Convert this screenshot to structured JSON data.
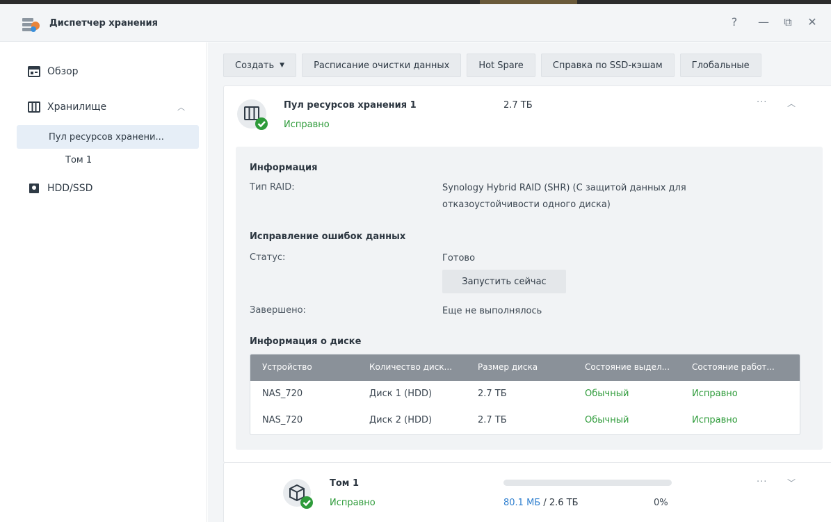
{
  "window": {
    "title": "Диспетчер хранения",
    "controls": [
      "?",
      "—",
      "⧉",
      "✕"
    ]
  },
  "sidebar": {
    "items": [
      {
        "label": "Обзор",
        "icon": "overview-icon"
      },
      {
        "label": "Хранилище",
        "icon": "storage-icon",
        "expanded": true
      },
      {
        "label": "Пул ресурсов хранени...",
        "active": true
      },
      {
        "label": "Том 1"
      },
      {
        "label": "HDD/SSD",
        "icon": "disk-icon"
      }
    ]
  },
  "toolbar": {
    "create": "Создать",
    "schedule": "Расписание очистки данных",
    "hotspare": "Hot Spare",
    "ssd_help": "Справка по SSD-кэшам",
    "global": "Глобальные"
  },
  "pool": {
    "name": "Пул ресурсов хранения 1",
    "status": "Исправно",
    "size": "2.7 ТБ",
    "more": "···",
    "info": {
      "title": "Информация",
      "raid_label": "Тип RAID:",
      "raid_value_line1": "Synology Hybrid RAID (SHR) (С защитой данных для",
      "raid_value_line2": "отказоустойчивости одного диска)",
      "scrub_title": "Исправление ошибок данных",
      "status_label": "Статус:",
      "status_value": "Готово",
      "run_button": "Запустить сейчас",
      "completed_label": "Завершено:",
      "completed_value": "Еще не выполнялось",
      "disk_title": "Информация о диске"
    },
    "disk_table": {
      "headers": [
        "Устройство",
        "Количество диск...",
        "Размер диска",
        "Состояние выдел...",
        "Состояние работ..."
      ],
      "rows": [
        [
          "NAS_720",
          "Диск 1 (HDD)",
          "2.7 ТБ",
          "Обычный",
          "Исправно"
        ],
        [
          "NAS_720",
          "Диск 2 (HDD)",
          "2.7 ТБ",
          "Обычный",
          "Исправно"
        ]
      ]
    }
  },
  "volume": {
    "name": "Том 1",
    "status": "Исправно",
    "used": "80.1 МБ",
    "total": " / 2.6 ТБ",
    "percent": "0%",
    "usage_fraction": 0.0,
    "more": "···"
  },
  "colors": {
    "ok_green": "#2e9b3a",
    "accent_blue": "#2f7fcf",
    "table_header": "#8a9199"
  }
}
